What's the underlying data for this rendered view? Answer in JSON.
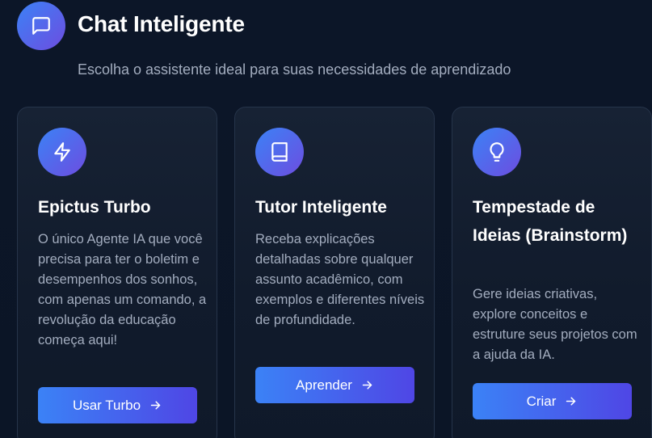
{
  "header": {
    "title": "Chat Inteligente",
    "subtitle": "Escolha o assistente ideal para suas necessidades de aprendizado",
    "icon": "chat-bubble-icon"
  },
  "cards": [
    {
      "icon": "lightning-icon",
      "title": "Epictus Turbo",
      "description": "O único Agente IA que você precisa para ter o boletim e desempenhos dos sonhos, com apenas um comando, a revolução da educação começa aqui!",
      "button_label": "Usar Turbo"
    },
    {
      "icon": "book-icon",
      "title": "Tutor Inteligente",
      "description": "Receba explicações detalhadas sobre qualquer assunto acadêmico, com exemplos e diferentes níveis de profundidade.",
      "button_label": "Aprender"
    },
    {
      "icon": "lightbulb-icon",
      "title": "Tempestade de Ideias (Brainstorm)",
      "description": "Gere ideias criativas, explore conceitos e estruture seus projetos com a ajuda da IA.",
      "button_label": "Criar"
    }
  ],
  "colors": {
    "background": "#0b1526",
    "card_background": "#131e30",
    "accent_start": "#3b82f6",
    "accent_end": "#4f46e5",
    "text_primary": "#ffffff",
    "text_secondary": "#a3adbf"
  }
}
